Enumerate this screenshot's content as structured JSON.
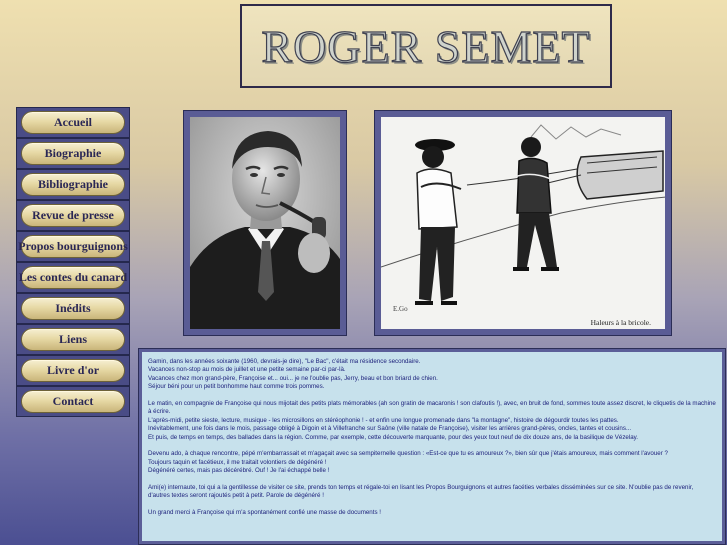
{
  "header": {
    "title": "ROGER SEMET"
  },
  "nav": {
    "items": [
      {
        "label": "Accueil"
      },
      {
        "label": "Biographie"
      },
      {
        "label": "Bibliographie"
      },
      {
        "label": "Revue de presse"
      },
      {
        "label": "Propos bourguignons"
      },
      {
        "label": "Les contes du canard"
      },
      {
        "label": "Inédits"
      },
      {
        "label": "Liens"
      },
      {
        "label": "Livre d'or"
      },
      {
        "label": "Contact"
      }
    ]
  },
  "images": {
    "portrait": {
      "icon": "portrait-photo"
    },
    "drawing": {
      "icon": "illustration-drawing",
      "caption": "Haleurs à la bricole."
    }
  },
  "content": {
    "paragraphs": [
      [
        "Gamin, dans les années soixante (1960, devrais-je dire), \"Le Bac\", c'était ma résidence secondaire.",
        "Vacances non-stop au mois de juillet et une petite semaine par-ci par-là.",
        "Vacances chez mon grand-père, Françoise et... oui... je ne l'oublie pas, Jerry, beau et bon briard de chien.",
        "Séjour béni pour un petit bonhomme haut comme trois pommes."
      ],
      [
        "Le matin, en compagnie de Françoise qui nous mijotait des petits plats mémorables (ah son gratin de macaronis ! son clafoutis !), avec, en bruit de fond, sommes toute assez discret, le cliquetis de la machine à écrire.",
        "L'après-midi, petite sieste, lecture, musique - les microsillons en stéréophonie ! - et enfin une longue promenade dans \"la montagne\", histoire de dégourdir toutes les pattes.",
        "Inévitablement, une fois dans le mois, passage obligé à Digoin et à Villefranche sur Saône (ville natale de Françoise), visiter les arrières grand-pères, oncles, tantes et cousins...",
        "Et puis, de temps en temps, des ballades dans la région. Comme, par exemple, cette découverte marquante, pour des yeux tout neuf de dix douze ans, de la basilique de Vézelay."
      ],
      [
        "Devenu ado, à chaque rencontre, pépé m'embarrassait et m'agaçait avec sa sempiternelle question : «Est-ce que tu es amoureux ?», bien sûr que j'étais amoureux, mais comment l'avouer ?",
        "Toujours taquin et facétieux, il me traitait volontiers de dégénéré !",
        "Dégénéré certes, mais pas décérébré. Ouf ! Je l'ai échappé belle !"
      ],
      [
        "Ami(e) internaute, toi qui a la gentillesse de visiter ce site, prends ton temps et régale-toi en lisant les Propos Bourguignons et autres facéties verbales disséminées sur ce site. N'oublie pas de revenir, d'autres textes seront rajoutés petit à petit. Parole de dégénéré !"
      ],
      [
        "Un grand merci à Françoise qui m'a spontanément confié une masse de documents !"
      ]
    ]
  },
  "colors": {
    "bg_top": "#efe0b0",
    "bg_bottom": "#4b4f92",
    "frame": "#5a5c95",
    "text_panel": "#c7e1ec",
    "text": "#1b1f7a",
    "nav_text": "#2a2755"
  }
}
